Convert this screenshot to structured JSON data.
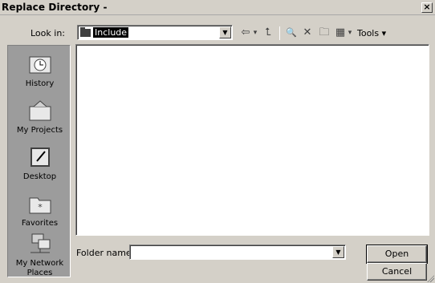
{
  "window": {
    "title": "Replace Directory -",
    "close_label": "×"
  },
  "toolbar": {
    "look_in_label": "Look in:",
    "look_in_value": "Include",
    "dropdown_arrow": "▼",
    "back_icon": "⇦",
    "back_arrow": "▾",
    "up_icon": "⮤",
    "search_icon": "🔍",
    "delete_icon": "✕",
    "new_folder_icon": "🗀",
    "views_icon": "▦",
    "views_arrow": "▾",
    "tools_label": "Tools ▾"
  },
  "places": [
    {
      "label": "History",
      "icon": "history-icon"
    },
    {
      "label": "My Projects",
      "icon": "my-projects-icon"
    },
    {
      "label": "Desktop",
      "icon": "desktop-icon"
    },
    {
      "label": "Favorites",
      "icon": "favorites-icon"
    },
    {
      "label": "My Network Places",
      "icon": "network-places-icon"
    }
  ],
  "footer": {
    "folder_name_label": "Folder name:",
    "folder_name_value": "",
    "open_label": "Open",
    "cancel_label": "Cancel"
  }
}
